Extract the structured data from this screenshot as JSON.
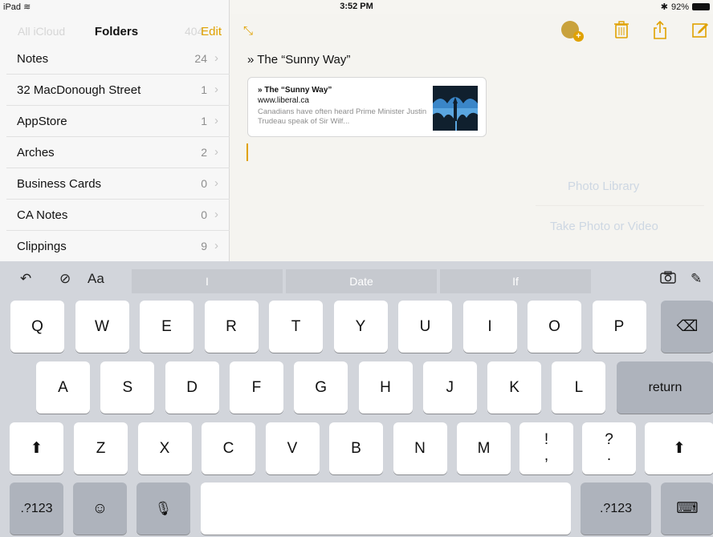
{
  "status_bar": {
    "device": "iPad",
    "time": "3:52 PM",
    "battery": "92%"
  },
  "sidebar": {
    "ghost_left": "All iCloud",
    "ghost_right": "404",
    "title": "Folders",
    "edit_label": "Edit",
    "folders": [
      {
        "name": "Notes",
        "count": "24"
      },
      {
        "name": "32 MacDonough Street",
        "count": "1"
      },
      {
        "name": "AppStore",
        "count": "1"
      },
      {
        "name": "Arches",
        "count": "2"
      },
      {
        "name": "Business Cards",
        "count": "0"
      },
      {
        "name": "CA Notes",
        "count": "0"
      },
      {
        "name": "Clippings",
        "count": "9"
      }
    ]
  },
  "note": {
    "title": "» The “Sunny Way”",
    "link_card": {
      "title": "» The “Sunny Way”",
      "url": "www.liberal.ca",
      "description": "Canadians have often heard Prime Minister Justin Trudeau speak of Sir Wilf..."
    },
    "menu_ghost": [
      "Photo Library",
      "Take Photo or Video"
    ],
    "accent_color": "#e0a100"
  },
  "keyboard": {
    "suggestions": [
      "I",
      "Date",
      "If"
    ],
    "row1": [
      "Q",
      "W",
      "E",
      "R",
      "T",
      "Y",
      "U",
      "I",
      "O",
      "P"
    ],
    "row2": [
      "A",
      "S",
      "D",
      "F",
      "G",
      "H",
      "J",
      "K",
      "L"
    ],
    "row3": [
      "Z",
      "X",
      "C",
      "V",
      "B",
      "N",
      "M"
    ],
    "punct1": [
      "!",
      ","
    ],
    "punct2": [
      "?",
      "."
    ],
    "return_label": "return",
    "numbers_label": ".?123",
    "format_label": "Aa"
  }
}
